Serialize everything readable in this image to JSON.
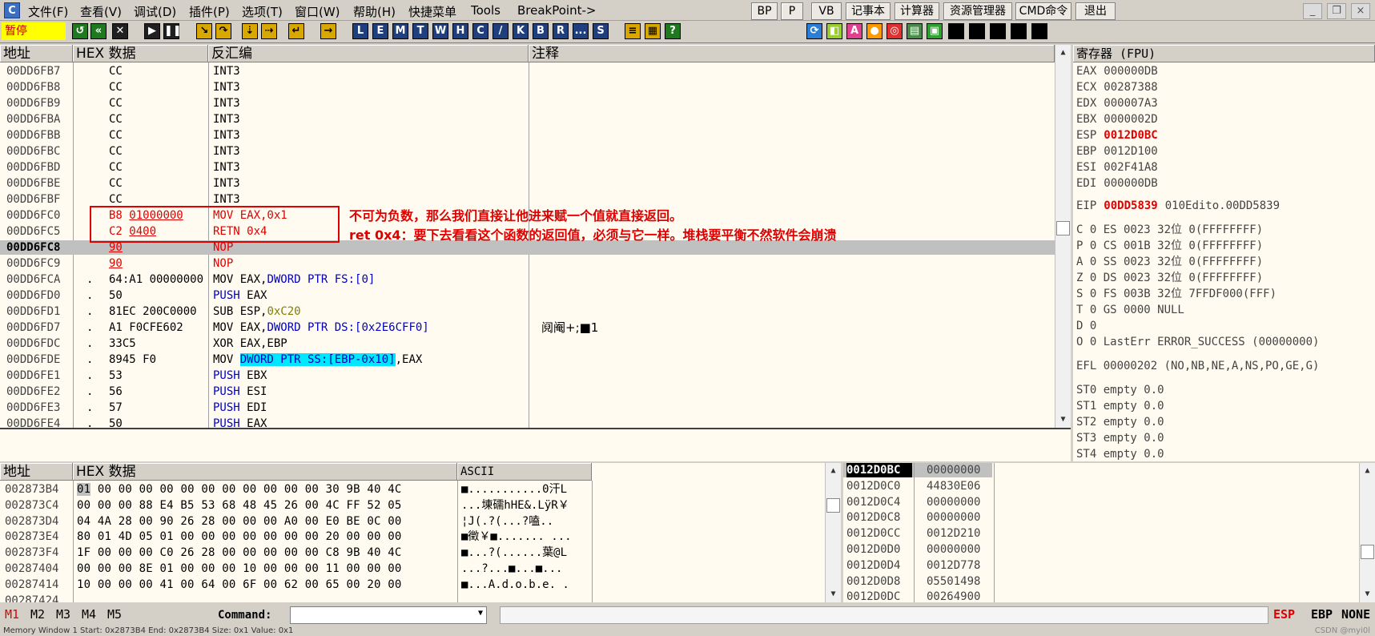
{
  "app": {
    "icon_letter": "C"
  },
  "menu": [
    "文件(F)",
    "查看(V)",
    "调试(D)",
    "插件(P)",
    "选项(T)",
    "窗口(W)",
    "帮助(H)",
    "快捷菜单",
    "Tools",
    "BreakPoint->"
  ],
  "top_buttons": [
    "BP",
    "P",
    "VB",
    "记事本",
    "计算器",
    "资源管理器",
    "CMD命令",
    "退出"
  ],
  "window_buttons": [
    "_",
    "❐",
    "×"
  ],
  "toolbar": {
    "status": "暂停",
    "letters": [
      "L",
      "E",
      "M",
      "T",
      "W",
      "H",
      "C",
      "/",
      "K",
      "B",
      "R",
      "...",
      "S"
    ]
  },
  "disasm": {
    "headers": {
      "address": "地址",
      "hex": "HEX 数据",
      "disasm": "反汇编",
      "comment": "注释"
    },
    "rows": [
      {
        "addr": "00DD6FB7",
        "mark": "",
        "hex": "CC",
        "asm": "INT3",
        "comment": ""
      },
      {
        "addr": "00DD6FB8",
        "mark": "",
        "hex": "CC",
        "asm": "INT3",
        "comment": ""
      },
      {
        "addr": "00DD6FB9",
        "mark": "",
        "hex": "CC",
        "asm": "INT3",
        "comment": ""
      },
      {
        "addr": "00DD6FBA",
        "mark": "",
        "hex": "CC",
        "asm": "INT3",
        "comment": ""
      },
      {
        "addr": "00DD6FBB",
        "mark": "",
        "hex": "CC",
        "asm": "INT3",
        "comment": ""
      },
      {
        "addr": "00DD6FBC",
        "mark": "",
        "hex": "CC",
        "asm": "INT3",
        "comment": ""
      },
      {
        "addr": "00DD6FBD",
        "mark": "",
        "hex": "CC",
        "asm": "INT3",
        "comment": ""
      },
      {
        "addr": "00DD6FBE",
        "mark": "",
        "hex": "CC",
        "asm": "INT3",
        "comment": ""
      },
      {
        "addr": "00DD6FBF",
        "mark": "",
        "hex": "CC",
        "asm": "INT3",
        "comment": ""
      },
      {
        "addr": "00DD6FC0",
        "mark": "",
        "hex": "B8 01000000",
        "asm": "MOV EAX,0x1",
        "comment": ""
      },
      {
        "addr": "00DD6FC5",
        "mark": "",
        "hex": "C2 0400",
        "asm": "RETN 0x4",
        "comment": ""
      },
      {
        "addr": "00DD6FC8",
        "mark": "",
        "hex": "90",
        "asm": "NOP",
        "comment": ""
      },
      {
        "addr": "00DD6FC9",
        "mark": "",
        "hex": "90",
        "asm": "NOP",
        "comment": ""
      },
      {
        "addr": "00DD6FCA",
        "mark": ".",
        "hex": "64:A1 00000000",
        "asm_parts": [
          "MOV EAX,",
          "DWORD PTR FS:[0]"
        ],
        "comment": ""
      },
      {
        "addr": "00DD6FD0",
        "mark": ".",
        "hex": "50",
        "asm_parts": [
          "PUSH",
          " EAX"
        ],
        "comment": ""
      },
      {
        "addr": "00DD6FD1",
        "mark": ".",
        "hex": "81EC 200C0000",
        "asm_parts": [
          "SUB ESP,",
          "0xC20"
        ],
        "comment": ""
      },
      {
        "addr": "00DD6FD7",
        "mark": ".",
        "hex": "A1 F0CFE602",
        "asm_parts": [
          "MOV EAX,",
          "DWORD PTR DS:[0x2E6CFF0]"
        ],
        "comment": "阋阉+;■1"
      },
      {
        "addr": "00DD6FDC",
        "mark": ".",
        "hex": "33C5",
        "asm": "XOR EAX,EBP",
        "comment": ""
      },
      {
        "addr": "00DD6FDE",
        "mark": ".",
        "hex": "8945 F0",
        "asm_parts": [
          "MOV ",
          "DWORD PTR SS:[EBP-0x10]",
          ",EAX"
        ],
        "comment": ""
      },
      {
        "addr": "00DD6FE1",
        "mark": ".",
        "hex": "53",
        "asm_parts": [
          "PUSH",
          " EBX"
        ],
        "comment": ""
      },
      {
        "addr": "00DD6FE2",
        "mark": ".",
        "hex": "56",
        "asm_parts": [
          "PUSH",
          " ESI"
        ],
        "comment": ""
      },
      {
        "addr": "00DD6FE3",
        "mark": ".",
        "hex": "57",
        "asm_parts": [
          "PUSH",
          " EDI"
        ],
        "comment": ""
      },
      {
        "addr": "00DD6FE4",
        "mark": ".",
        "hex": "50",
        "asm_parts": [
          "PUSH",
          " EAX"
        ],
        "comment": ""
      }
    ],
    "annotation_line1": "不可为负数，那么我们直接让他进来赋一个值就直接返回。",
    "annotation_line2": "ret 0x4：要下去看看这个函数的返回值，必须与它一样。堆栈要平衡不然软件会崩溃"
  },
  "registers": {
    "header": "寄存器 (FPU)",
    "general": [
      {
        "name": "EAX",
        "value": "000000DB",
        "changed": false
      },
      {
        "name": "ECX",
        "value": "00287388",
        "changed": false
      },
      {
        "name": "EDX",
        "value": "000007A3",
        "changed": false
      },
      {
        "name": "EBX",
        "value": "0000002D",
        "changed": false
      },
      {
        "name": "ESP",
        "value": "0012D0BC",
        "changed": true
      },
      {
        "name": "EBP",
        "value": "0012D100",
        "changed": false
      },
      {
        "name": "ESI",
        "value": "002F41A8",
        "changed": false
      },
      {
        "name": "EDI",
        "value": "000000DB",
        "changed": false
      }
    ],
    "eip": {
      "name": "EIP",
      "value": "00DD5839",
      "comment": "010Edito.00DD5839"
    },
    "flags": [
      "C 0  ES 0023 32位 0(FFFFFFFF)",
      "P 0  CS 001B 32位 0(FFFFFFFF)",
      "A 0  SS 0023 32位 0(FFFFFFFF)",
      "Z 0  DS 0023 32位 0(FFFFFFFF)",
      "S 0  FS 003B 32位 7FFDF000(FFF)",
      "T 0  GS 0000 NULL",
      "D 0",
      "O 0  LastErr ERROR_SUCCESS (00000000)"
    ],
    "efl": "EFL 00000202 (NO,NB,NE,A,NS,PO,GE,G)",
    "fpu": [
      "ST0 empty 0.0",
      "ST1 empty 0.0",
      "ST2 empty 0.0",
      "ST3 empty 0.0",
      "ST4 empty 0.0"
    ]
  },
  "dump": {
    "headers": {
      "address": "地址",
      "hex": "HEX 数据",
      "ascii": "ASCII"
    },
    "rows": [
      {
        "addr": "002873B4",
        "hex": "01 00 00 00 00 00 00 00 00 00 00 00 30 9B 40 4C",
        "ascii": "■...........0汗L"
      },
      {
        "addr": "002873C4",
        "hex": "00 00 00 88 E4 B5 53 68 48 45 26 00 4C FF 52 05",
        "ascii": "...埬礝hHE&.LÿR￥"
      },
      {
        "addr": "002873D4",
        "hex": "04 4A 28 00 90 26 28 00 00 00 A0 00 E0 BE 0C 00",
        "ascii": "¦J(.?(...?嗑.."
      },
      {
        "addr": "002873E4",
        "hex": "80 01 4D 05 01 00 00 00 00 00 00 00 20 00 00 00",
        "ascii": "■徵￥■....... ..."
      },
      {
        "addr": "002873F4",
        "hex": "1F 00 00 00 C0 26 28 00 00 00 00 00 C8 9B 40 4C",
        "ascii": "■...?(......葉@L"
      },
      {
        "addr": "00287404",
        "hex": "00 00 00 8E 01 00 00 00 10 00 00 00 11 00 00 00",
        "ascii": "...?...■...■..."
      },
      {
        "addr": "00287414",
        "hex": "10 00 00 00 41 00 64 00 6F 00 62 00 65 00 20 00",
        "ascii": "■...A.d.o.b.e. ."
      },
      {
        "addr": "00287424",
        "hex": "",
        "ascii": ""
      }
    ]
  },
  "stack": {
    "rows": [
      {
        "addr": "0012D0BC",
        "value": "00000000",
        "current": true
      },
      {
        "addr": "0012D0C0",
        "value": "44830E06",
        "current": false
      },
      {
        "addr": "0012D0C4",
        "value": "00000000",
        "current": false
      },
      {
        "addr": "0012D0C8",
        "value": "00000000",
        "current": false
      },
      {
        "addr": "0012D0CC",
        "value": "0012D210",
        "current": false
      },
      {
        "addr": "0012D0D0",
        "value": "00000000",
        "current": false
      },
      {
        "addr": "0012D0D4",
        "value": "0012D778",
        "current": false
      },
      {
        "addr": "0012D0D8",
        "value": "05501498",
        "current": false
      },
      {
        "addr": "0012D0DC",
        "value": "00264900",
        "current": false
      }
    ]
  },
  "command_bar": {
    "marks": [
      "M1",
      "M2",
      "M3",
      "M4",
      "M5"
    ],
    "command_label": "Command:",
    "command_value": "",
    "right": [
      "ESP",
      "EBP",
      "NONE"
    ]
  },
  "footer": {
    "status": "Memory Window 1  Start: 0x2873B4  End: 0x2873B4  Size: 0x1  Value: 0x1",
    "watermark": "CSDN @myi0l"
  },
  "colors": {
    "accent_red": "#e00000",
    "keyword_blue": "#0000c0",
    "highlight_cyan": "#00e8ff",
    "pane_bg": "#fffbf0"
  }
}
